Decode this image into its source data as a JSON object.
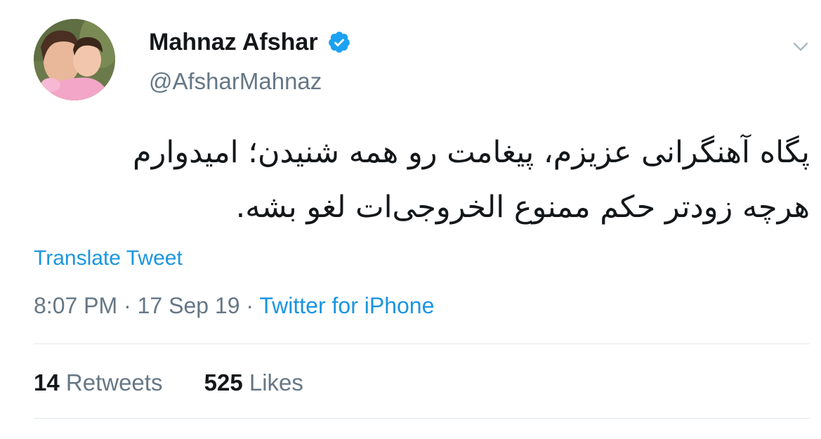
{
  "author": {
    "name": "Mahnaz Afshar",
    "handle": "@AfsharMahnaz",
    "verified": true,
    "verified_color": "#1da1f2"
  },
  "tweet": {
    "text_lines": [
      "پگاه آهنگرانی عزیزم، پیغامت رو همه شنیدن؛ امیدوارم",
      "هرچه زودتر حکم ممنوع الخروجی‌ات لغو بشه."
    ],
    "translate_label": "Translate Tweet",
    "time": "8:07 PM",
    "separator": "·",
    "date": "17 Sep 19",
    "source": "Twitter for iPhone"
  },
  "stats": {
    "retweets_count": "14",
    "retweets_label": "Retweets",
    "likes_count": "525",
    "likes_label": "Likes"
  },
  "colors": {
    "link": "#1b95e0",
    "secondary_text": "#657786",
    "primary_text": "#14171a",
    "divider": "#e1e8ed"
  },
  "icons": {
    "verified": "verified-badge-icon",
    "more": "chevron-down-icon"
  }
}
